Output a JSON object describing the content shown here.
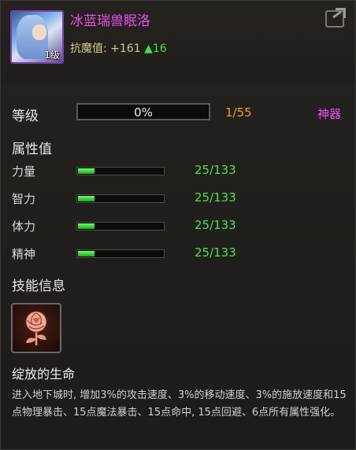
{
  "header": {
    "name": "冰蓝瑞兽眠洛",
    "portrait_level": "1级",
    "resist_label": "抗魔值: ",
    "resist_value": "+161",
    "resist_increase": "▲16"
  },
  "level": {
    "label": "等级",
    "progress_text": "0%",
    "progress_fraction": 0,
    "fraction": "1/55",
    "type_tag": "神器"
  },
  "attributes": {
    "title": "属性值",
    "items": [
      {
        "label": "力量",
        "value": "25/133",
        "fraction": 0.188
      },
      {
        "label": "智力",
        "value": "25/133",
        "fraction": 0.188
      },
      {
        "label": "体力",
        "value": "25/133",
        "fraction": 0.188
      },
      {
        "label": "精神",
        "value": "25/133",
        "fraction": 0.188
      }
    ]
  },
  "skill": {
    "section_title": "技能信息",
    "icon": "rose-icon",
    "name": "绽放的生命",
    "description": "进入地下城时, 增加3%的攻击速度、3%的移动速度、3%的施放速度和15点物理暴击、15点魔法暴击、15点命中, 15点回避、6点所有属性强化。"
  },
  "colors": {
    "name": "#e54fe8",
    "level_fraction": "#f0a020",
    "artifact": "#ef4cf0",
    "stat_value": "#4ee04e",
    "bar_fill": "#2fd42f"
  }
}
